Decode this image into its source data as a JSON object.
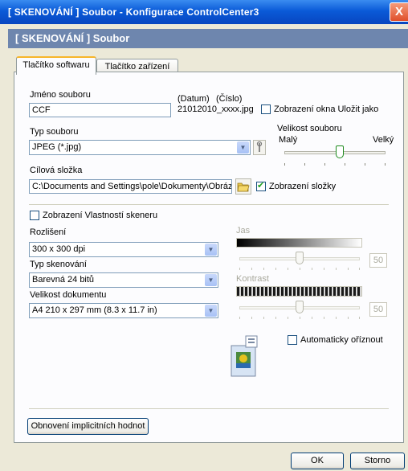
{
  "window": {
    "title": "[ SKENOVÁNÍ ]  Soubor - Konfigurace ControlCenter3",
    "close": "X"
  },
  "header": {
    "title": "[ SKENOVÁNÍ ]  Soubor"
  },
  "tabs": [
    {
      "label": "Tlačítko softwaru",
      "active": true
    },
    {
      "label": "Tlačítko zařízení",
      "active": false
    }
  ],
  "filename": {
    "label": "Jméno souboru",
    "value": "CCF",
    "datum_label": "(Datum)",
    "cislo_label": "(Číslo)",
    "sample": "21012010_xxxx.jpg",
    "show_save_as_label": "Zobrazení okna Uložit jako",
    "show_save_as_checked": false
  },
  "filetype": {
    "label": "Typ souboru",
    "value": "JPEG (*.jpg)"
  },
  "filesize": {
    "label": "Velikost souboru",
    "small": "Malý",
    "large": "Velký",
    "level": 0.55
  },
  "destination": {
    "label": "Cílová složka",
    "value": "C:\\Documents and Settings\\pole\\Dokumenty\\Obrázk",
    "show_folder_label": "Zobrazení složky",
    "show_folder_checked": true
  },
  "scanner_props": {
    "label": "Zobrazení Vlastností skeneru",
    "checked": false
  },
  "resolution": {
    "label": "Rozlišení",
    "value": "300 x 300 dpi"
  },
  "scan_type": {
    "label": "Typ skenování",
    "value": "Barevná 24 bitů"
  },
  "doc_size": {
    "label": "Velikost dokumentu",
    "value": "A4 210 x 297 mm (8.3 x 11.7 in)"
  },
  "brightness": {
    "label": "Jas",
    "value": "50",
    "level": 0.5
  },
  "contrast": {
    "label": "Kontrast",
    "value": "50",
    "level": 0.5
  },
  "auto_crop": {
    "label": "Automaticky oříznout",
    "checked": false
  },
  "buttons": {
    "restore_defaults": "Obnovení implicitních hodnot",
    "ok": "OK",
    "cancel": "Storno"
  },
  "colors": {
    "title_bar": "#0a5ad8",
    "subheader": "#6e86ae",
    "dialog_bg": "#ece9d8"
  }
}
